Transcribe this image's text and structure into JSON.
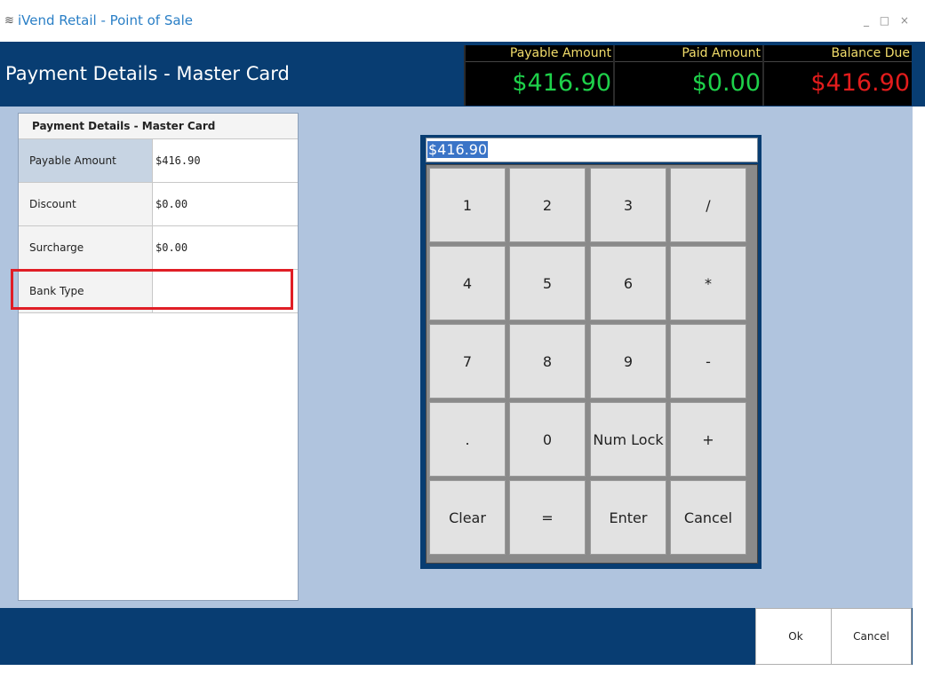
{
  "window": {
    "title": "iVend Retail - Point of Sale",
    "controls": "_ □ ×"
  },
  "header": {
    "title": "Payment Details - Master Card",
    "payable": {
      "label": "Payable Amount",
      "value": "$416.90",
      "color": "#1ed14a"
    },
    "paid": {
      "label": "Paid Amount",
      "value": "$0.00",
      "color": "#1ed14a"
    },
    "balance": {
      "label": "Balance Due",
      "value": "$416.90",
      "color": "#e21c1c"
    }
  },
  "details": {
    "heading": "Payment Details - Master Card",
    "rows": [
      {
        "key": "Payable Amount",
        "value": "$416.90"
      },
      {
        "key": "Discount",
        "value": "$0.00"
      },
      {
        "key": "Surcharge",
        "value": "$0.00"
      },
      {
        "key": "Bank Type",
        "value": ""
      }
    ]
  },
  "keypad": {
    "input_value": "$416.90",
    "keys": [
      "1",
      "2",
      "3",
      "/",
      "4",
      "5",
      "6",
      "*",
      "7",
      "8",
      "9",
      "-",
      ".",
      "0",
      "Num Lock",
      "+",
      "Clear",
      "=",
      "Enter",
      "Cancel"
    ]
  },
  "footer": {
    "ok_label": "Ok",
    "cancel_label": "Cancel"
  }
}
